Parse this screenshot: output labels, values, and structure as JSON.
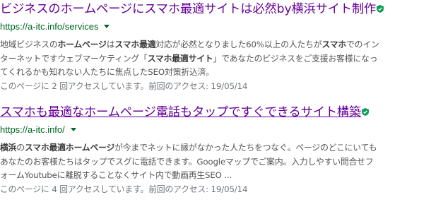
{
  "results": [
    {
      "title": "ビジネスのホームページにスマホ最適サイトは必然by横浜サイト制作",
      "url": "https://a-itc.info/services",
      "snippet_lines": [
        [
          {
            "t": "地域ビジネスの"
          },
          {
            "t": "ホームページ",
            "b": true
          },
          {
            "t": "は"
          },
          {
            "t": "スマホ最適",
            "b": true
          },
          {
            "t": "対応が必然となりました60%以上の人たちが"
          },
          {
            "t": "スマホ",
            "b": true
          },
          {
            "t": "でのイン"
          }
        ],
        [
          {
            "t": "ターネットですウェブマーケティング「"
          },
          {
            "t": "スマホ最適サイト",
            "b": true
          },
          {
            "t": "」であなたのビジネスをご支援お客様になっ"
          }
        ],
        [
          {
            "t": "てくれるかも知れない人たちに焦点したSEO対策折込済。"
          }
        ]
      ],
      "visit_info": "このページに 2 回アクセスしています。前回のアクセス: 19/05/14"
    },
    {
      "title": "スマホも最適なホームページ電話もタップですぐできるサイト構築",
      "url": "https://a-itc.info/",
      "snippet_lines": [
        [
          {
            "t": "横浜",
            "b": true
          },
          {
            "t": "の"
          },
          {
            "t": "スマホ最適ホームページ",
            "b": true
          },
          {
            "t": "が今までネットに縁がなかった人たちをつなぐ。ページのどこにいても"
          }
        ],
        [
          {
            "t": "あなたのお客様たちはタップでスグに電話できます。Googleマップでご案内。入力しやすい問合せフ"
          }
        ],
        [
          {
            "t": "ォームYoutubeに離脱することなくサイト内で動画再生SEO ..."
          }
        ]
      ],
      "visit_info": "このページに 4 回アクセスしています。前回のアクセス: 19/05/14"
    }
  ],
  "colors": {
    "title": "#660099",
    "url": "#006621",
    "verified": "#0f9d58",
    "snippet": "#545454"
  },
  "icons": {
    "verified": "verified-shield-icon",
    "caret": "caret-down-icon"
  }
}
